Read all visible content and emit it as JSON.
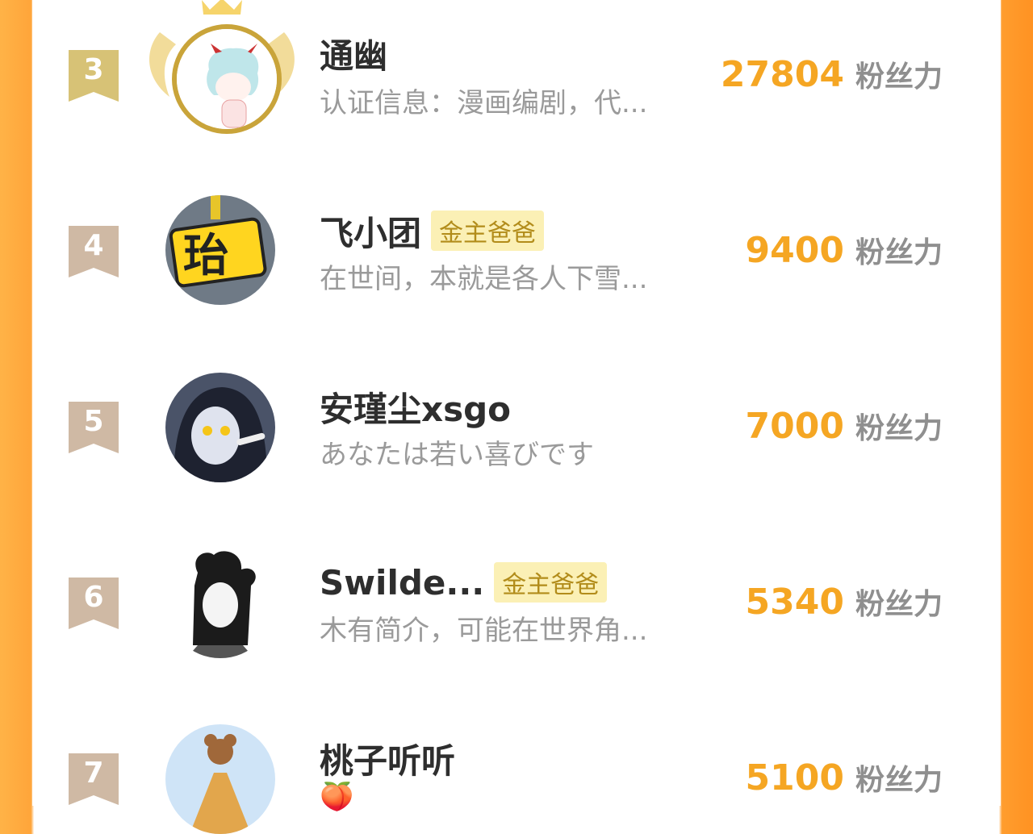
{
  "colors": {
    "accent": "#f5a623",
    "border_left": "#ffa53a",
    "border_right": "#ff9222",
    "badge_bg": "#fbf0b5",
    "rank_gold": "#d7c276",
    "rank_tan": "#cfb9a4"
  },
  "score_unit": "粉丝力",
  "ranking": [
    {
      "rank": "3",
      "name": "通幽",
      "badge": "",
      "bio": "认证信息：漫画编剧，代...",
      "score": "27804",
      "avatar": "chibi-demon-avatar",
      "crown": true
    },
    {
      "rank": "4",
      "name": "飞小团",
      "badge": "金主爸爸",
      "bio": "在世间，本就是各人下雪...",
      "score": "9400",
      "avatar": "yellow-character-avatar",
      "crown": false
    },
    {
      "rank": "5",
      "name": "安瑾尘xsgo",
      "badge": "",
      "bio": "あなたは若い喜びです",
      "score": "7000",
      "avatar": "anime-girl-avatar",
      "crown": false
    },
    {
      "rank": "6",
      "name": "Swilde...",
      "badge": "金主爸爸",
      "bio": "木有简介，可能在世界角...",
      "score": "5340",
      "avatar": "horned-sketch-avatar",
      "crown": false
    },
    {
      "rank": "7",
      "name": "桃子听听",
      "badge": "",
      "bio": "🍑",
      "score": "5100",
      "avatar": "teddy-bear-avatar",
      "crown": false
    }
  ]
}
